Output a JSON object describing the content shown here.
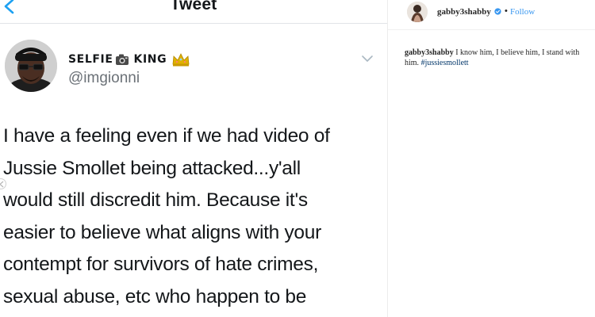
{
  "twitter": {
    "header": {
      "title": "Tweet"
    },
    "author": {
      "name_part1": "SELFIE",
      "name_part2": "KING",
      "handle": "@imgionni"
    },
    "tweet_lines": [
      "I have a feeling even if we had video of",
      "Jussie Smollet being attacked...y'all",
      "would still discredit him. Because it's",
      "easier to believe what aligns with your",
      "contempt for survivors of hate crimes,",
      "sexual abuse, etc who happen to be"
    ],
    "icons": {
      "back": "back-arrow-icon",
      "camera": "camera-emoji-icon",
      "crown": "crown-emoji-icon",
      "chevron": "chevron-down-icon"
    },
    "colors": {
      "text": "#14171a",
      "muted": "#6b7177",
      "crown": "#e0b000"
    }
  },
  "instagram": {
    "username": "gabby3shabby",
    "dot": "•",
    "follow_label": "Follow",
    "caption_user": "gabby3shabby",
    "caption_text": "I know him, I believe him, I stand with him.",
    "caption_tag": "#jussiesmollett",
    "icons": {
      "verified": "verified-badge-icon"
    },
    "colors": {
      "follow": "#3897f0",
      "verified": "#3897f0",
      "tag": "#003569"
    }
  }
}
